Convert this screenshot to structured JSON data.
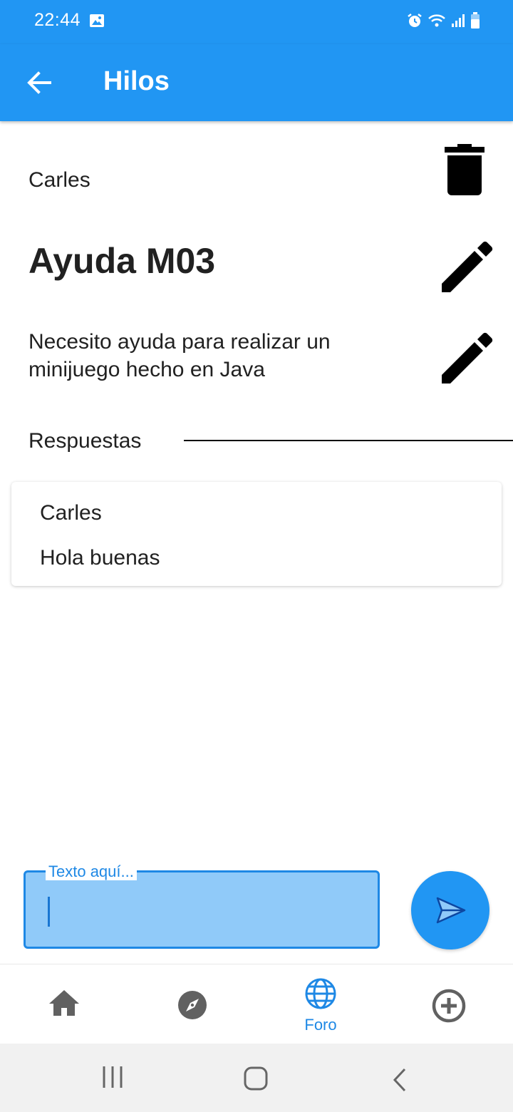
{
  "status_bar": {
    "time": "22:44",
    "icons": [
      "image-icon",
      "alarm-icon",
      "wifi-icon",
      "signal-icon",
      "battery-icon"
    ]
  },
  "app_bar": {
    "title": "Hilos",
    "back_icon": "arrow-left-icon"
  },
  "thread": {
    "author": "Carles",
    "title": "Ayuda M03",
    "body": "Necesito ayuda para realizar un minijuego hecho en Java"
  },
  "responses": {
    "label": "Respuestas",
    "items": [
      {
        "author": "Carles",
        "text": "Hola buenas"
      }
    ]
  },
  "composer": {
    "label": "Texto aquí...",
    "value": ""
  },
  "bottom_nav": {
    "items": [
      {
        "icon": "home-icon",
        "label": ""
      },
      {
        "icon": "compass-icon",
        "label": ""
      },
      {
        "icon": "globe-icon",
        "label": "Foro",
        "active": true
      },
      {
        "icon": "add-circle-icon",
        "label": ""
      }
    ]
  },
  "colors": {
    "primary": "#2196F3",
    "input_fill": "#90CAF9",
    "active_nav": "#1E88E5",
    "inactive_nav": "#616161"
  }
}
